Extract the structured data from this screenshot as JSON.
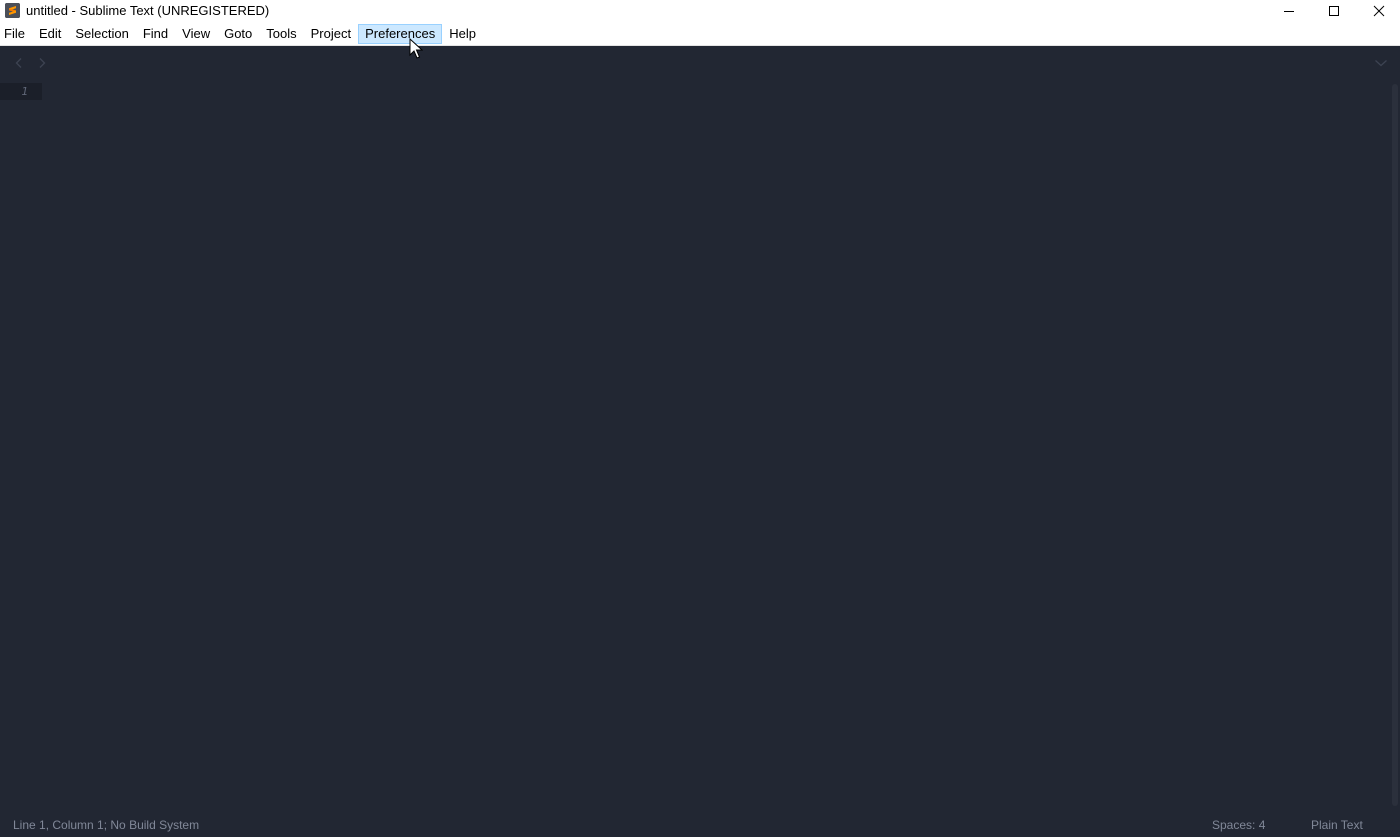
{
  "window": {
    "title": "untitled - Sublime Text (UNREGISTERED)",
    "icon": "sublime-text-logo-icon"
  },
  "menu": {
    "items": [
      {
        "label": "File"
      },
      {
        "label": "Edit"
      },
      {
        "label": "Selection"
      },
      {
        "label": "Find"
      },
      {
        "label": "View"
      },
      {
        "label": "Goto"
      },
      {
        "label": "Tools"
      },
      {
        "label": "Project"
      },
      {
        "label": "Preferences",
        "hovered": true
      },
      {
        "label": "Help"
      }
    ]
  },
  "editor": {
    "line_numbers": [
      "1"
    ],
    "content": ""
  },
  "status": {
    "position": "Line 1, Column 1; No Build System",
    "indent": "Spaces: 4",
    "syntax": "Plain Text"
  },
  "colors": {
    "editor_background": "#222733",
    "gutter_active": "#1b1f29",
    "menu_hover": "#cce8ff",
    "status_text": "#818898"
  }
}
